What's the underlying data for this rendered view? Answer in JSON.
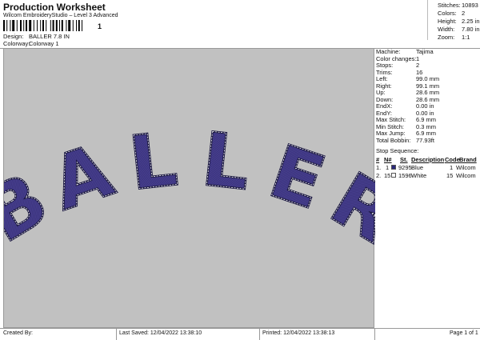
{
  "header": {
    "title": "Production Worksheet",
    "subtitle": "Wilcom EmbroideryStudio – Level 3 Advanced",
    "barcode_text": "1",
    "design_label": "Design:",
    "design_value": "BALLER 7.8 IN",
    "colorway_label": "Colorway:",
    "colorway_value": "Colorway 1"
  },
  "stats": [
    {
      "label": "Stitches:",
      "value": "10893"
    },
    {
      "label": "Colors:",
      "value": "2"
    },
    {
      "label": "Height:",
      "value": "2.25 in"
    },
    {
      "label": "Width:",
      "value": "7.80 in"
    },
    {
      "label": "Zoom:",
      "value": "1:1"
    }
  ],
  "design_preview": {
    "letters": [
      "B",
      "A",
      "L",
      "L",
      "E",
      "R"
    ],
    "fill_color": "#3d3580",
    "outline_color": "#1a1740",
    "stitch_color": "#ffffff"
  },
  "machine_info": [
    {
      "label": "Machine:",
      "value": "Tajima"
    },
    {
      "label": "Color changes:",
      "value": "1"
    },
    {
      "label": "Stops:",
      "value": "2"
    },
    {
      "label": "Trims:",
      "value": "16"
    },
    {
      "label": "Left:",
      "value": "99.0 mm"
    },
    {
      "label": "Right:",
      "value": "99.1 mm"
    },
    {
      "label": "Up:",
      "value": "28.6 mm"
    },
    {
      "label": "Down:",
      "value": "28.6 mm"
    },
    {
      "label": "EndX:",
      "value": "0.00 in"
    },
    {
      "label": "EndY:",
      "value": "0.00 in"
    },
    {
      "label": "Max Stitch:",
      "value": "6.9 mm"
    },
    {
      "label": "Min Stitch:",
      "value": "0.3 mm"
    },
    {
      "label": "Max Jump:",
      "value": "6.9 mm"
    },
    {
      "label": "Total Bobbin:",
      "value": "77.93ft"
    }
  ],
  "stop_sequence": {
    "title": "Stop Sequence:",
    "columns": [
      "#",
      "N#",
      "St.",
      "Description",
      "Code",
      "Brand"
    ],
    "rows": [
      {
        "num": "1.",
        "n": "1",
        "st": "9295",
        "color": "#2b2a7a",
        "description": "Blue",
        "code": "1",
        "brand": "Wilcom"
      },
      {
        "num": "2.",
        "n": "15",
        "st": "1596",
        "color": "#ffffff",
        "description": "White",
        "code": "15",
        "brand": "Wilcom"
      }
    ]
  },
  "footer": {
    "created_by": "Created By:",
    "last_saved": "Last Saved: 12/04/2022 13:38:10",
    "printed": "Printed: 12/04/2022 13:38:13",
    "page": "Page 1 of 1"
  }
}
